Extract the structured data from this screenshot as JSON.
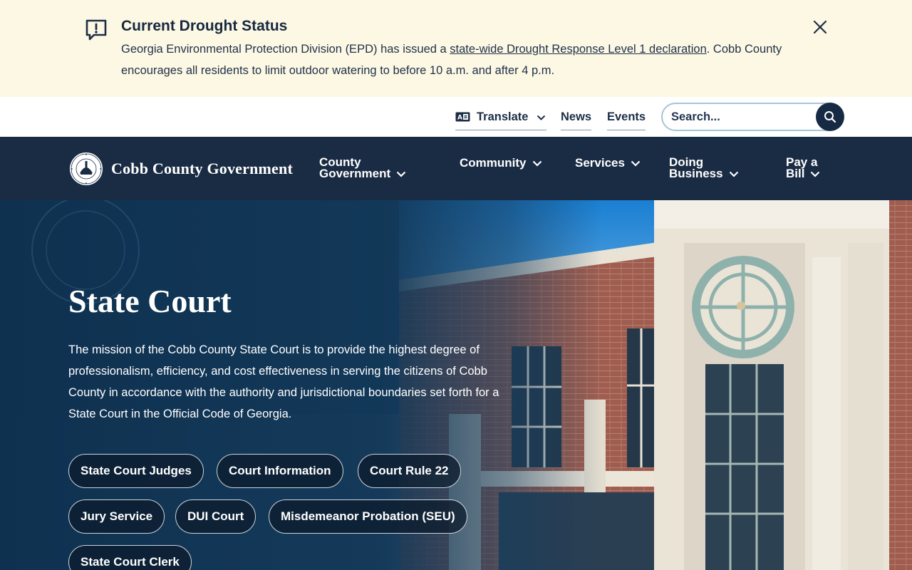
{
  "alert": {
    "title": "Current Drought Status",
    "text_before": "Georgia Environmental Protection Division (EPD) has issued a ",
    "link": "state-wide Drought Response Level 1 declaration",
    "text_after": ". Cobb County encourages all residents to limit outdoor watering to before 10 a.m. and after 4 p.m.",
    "icon": "alert-speech-bubble-icon",
    "close_icon": "close-icon"
  },
  "utility": {
    "translate": "Translate",
    "news": "News",
    "events": "Events",
    "search_placeholder": "Search..."
  },
  "nav": {
    "logo_text": "Cobb County Government",
    "items": [
      {
        "line1": "County",
        "line2": "Government"
      },
      {
        "line1": "Community",
        "line2": ""
      },
      {
        "line1": "Services",
        "line2": ""
      },
      {
        "line1": "Doing",
        "line2": "Business"
      },
      {
        "line1": "Pay a",
        "line2": "Bill"
      }
    ]
  },
  "hero": {
    "title": "State Court",
    "description": "The mission of the Cobb County State Court is to provide the highest degree of professionalism, efficiency, and cost effectiveness in serving the citizens of Cobb County in accordance with the authority and jurisdictional boundaries set forth for a State Court in the Official Code of Georgia.",
    "links": [
      "State Court Judges",
      "Court Information",
      "Court Rule 22",
      "Jury Service",
      "DUI Court",
      "Misdemeanor Probation (SEU)",
      "State Court Clerk"
    ]
  },
  "colors": {
    "alert_bg": "#fdf8e4",
    "nav_bg": "#1a2c44",
    "search_button": "#172a43",
    "brick": "#9a5a4c"
  }
}
